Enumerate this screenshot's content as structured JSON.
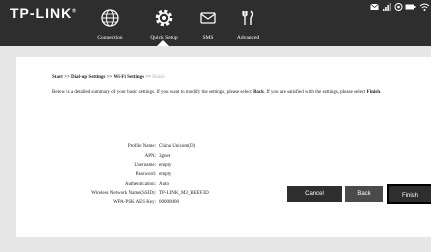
{
  "header": {
    "logo": "TP-LINK",
    "logo_mark": "®",
    "nav": [
      {
        "label": "Connection",
        "icon": "globe-icon"
      },
      {
        "label": "Quick Setup",
        "icon": "gear-icon"
      },
      {
        "label": "SMS",
        "icon": "envelope-icon"
      },
      {
        "label": "Advanced",
        "icon": "tools-icon"
      }
    ],
    "status_icons": [
      "mail-icon",
      "signal-icon",
      "data-icon",
      "battery-icon",
      "wifi-icon"
    ]
  },
  "breadcrumb": {
    "step1": "Start",
    "sep1": " >> ",
    "step2": "Dial-up Settings",
    "sep2": " >> ",
    "step3": "Wi-Fi Settings",
    "sep3": " >> ",
    "current": "Finish"
  },
  "summary": {
    "text_a": "Below is a detailed summary of your basic settings. If you want to modify the settings, please select ",
    "back_word": "Back",
    "text_b": ". If you are satisfied with the settings, please select ",
    "finish_word": "Finish",
    "text_c": "."
  },
  "settings": [
    {
      "key": "Profile Name:",
      "value": "China Unicom(D)"
    },
    {
      "key": "APN:",
      "value": "3gnet"
    },
    {
      "key": "Username:",
      "value": "empty"
    },
    {
      "key": "Password:",
      "value": "empty"
    },
    {
      "key": "Authentication:",
      "value": "Auto"
    },
    {
      "key": "Wireless Network Name(SSID):",
      "value": "TP-LINK_M3_BEEF3D"
    },
    {
      "key": "WPA-PSK AES Key:",
      "value": "00000000"
    }
  ],
  "buttons": {
    "cancel": "Cancel",
    "back": "Back",
    "finish": "Finish"
  },
  "colors": {
    "header_bg": "#2e2e2e",
    "page_bg": "#e7e7e7",
    "panel_bg": "#ffffff",
    "breadcrumb_current": "#aaaaaa"
  }
}
